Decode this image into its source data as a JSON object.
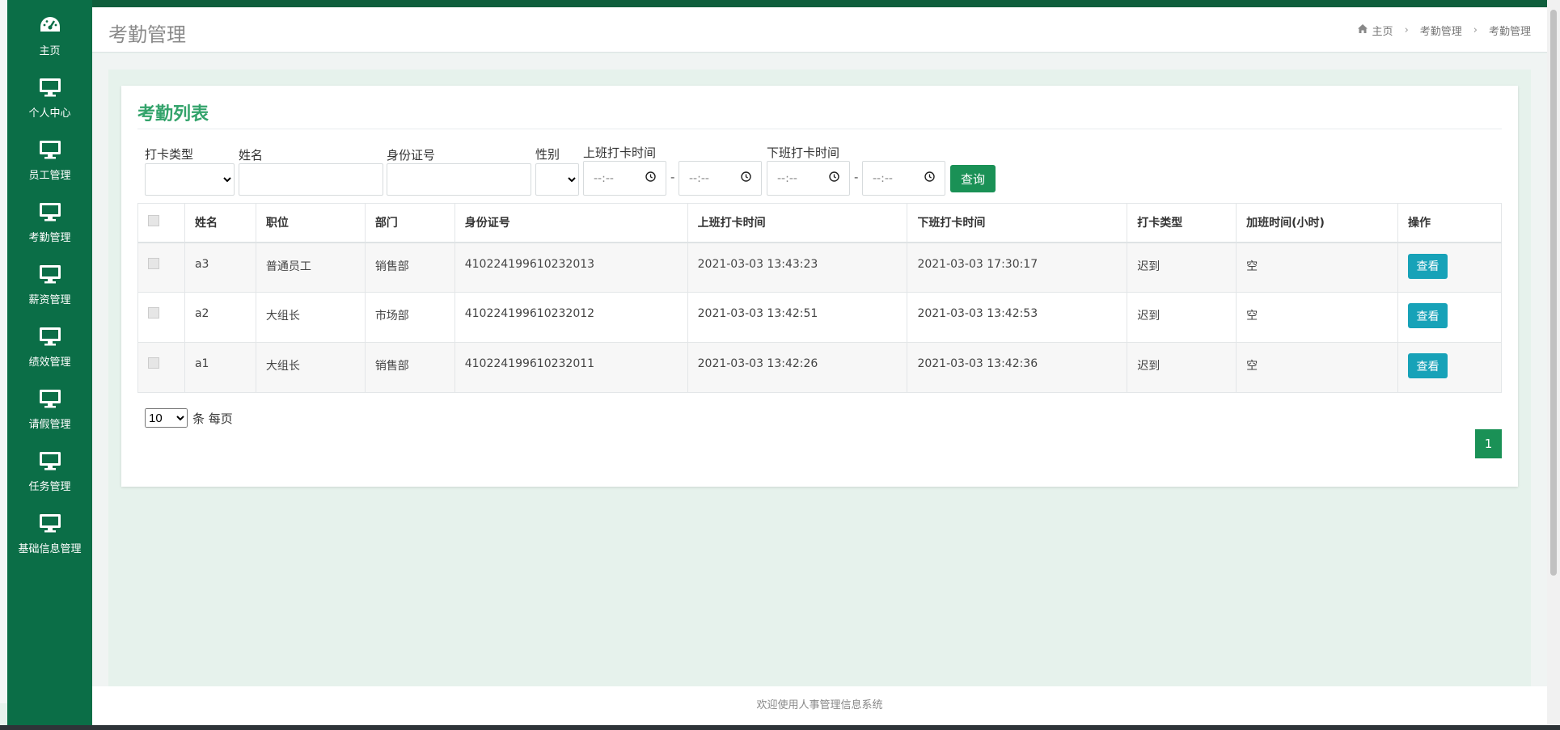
{
  "sidebar": {
    "items": [
      {
        "label": "主页",
        "icon": "dashboard-icon"
      },
      {
        "label": "个人中心",
        "icon": "monitor-icon"
      },
      {
        "label": "员工管理",
        "icon": "monitor-icon"
      },
      {
        "label": "考勤管理",
        "icon": "monitor-icon"
      },
      {
        "label": "薪资管理",
        "icon": "monitor-icon"
      },
      {
        "label": "绩效管理",
        "icon": "monitor-icon"
      },
      {
        "label": "请假管理",
        "icon": "monitor-icon"
      },
      {
        "label": "任务管理",
        "icon": "monitor-icon"
      },
      {
        "label": "基础信息管理",
        "icon": "monitor-icon"
      }
    ]
  },
  "header": {
    "title": "考勤管理",
    "breadcrumb": [
      "主页",
      "考勤管理",
      "考勤管理"
    ]
  },
  "card": {
    "title": "考勤列表"
  },
  "filters": {
    "punch_type_label": "打卡类型",
    "name_label": "姓名",
    "id_label": "身份证号",
    "gender_label": "性别",
    "checkin_label": "上班打卡时间",
    "checkout_label": "下班打卡时间",
    "time_placeholder": "--:--",
    "range_dash": "-",
    "query_label": "查询"
  },
  "table": {
    "headers": [
      "姓名",
      "职位",
      "部门",
      "身份证号",
      "上班打卡时间",
      "下班打卡时间",
      "打卡类型",
      "加班时间(小时)",
      "操作"
    ],
    "view_label": "查看",
    "rows": [
      {
        "name": "a3",
        "position": "普通员工",
        "dept": "销售部",
        "id": "410224199610232013",
        "checkin": "2021-03-03 13:43:23",
        "checkout": "2021-03-03 17:30:17",
        "type": "迟到",
        "overtime": "空"
      },
      {
        "name": "a2",
        "position": "大组长",
        "dept": "市场部",
        "id": "410224199610232012",
        "checkin": "2021-03-03 13:42:51",
        "checkout": "2021-03-03 13:42:53",
        "type": "迟到",
        "overtime": "空"
      },
      {
        "name": "a1",
        "position": "大组长",
        "dept": "销售部",
        "id": "410224199610232011",
        "checkin": "2021-03-03 13:42:26",
        "checkout": "2021-03-03 13:42:36",
        "type": "迟到",
        "overtime": "空"
      }
    ]
  },
  "pagination": {
    "page_size": "10",
    "page_size_suffix": "条 每页",
    "current_page": "1"
  },
  "footer": {
    "text": "欢迎使用人事管理信息系统"
  },
  "colors": {
    "sidebar": "#0b6e47",
    "accent": "#1a9156",
    "view_button": "#17a2b8",
    "title_green": "#33a36b"
  }
}
